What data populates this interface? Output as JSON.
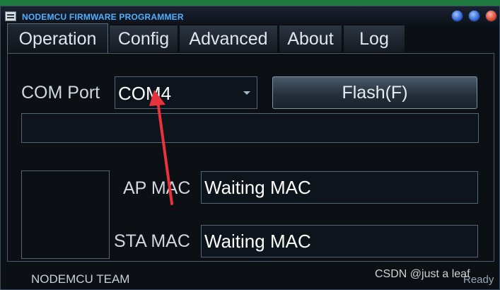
{
  "window": {
    "title": "NODEMCU FIRMWARE PROGRAMMER",
    "controls": [
      "minimize",
      "maximize",
      "close"
    ]
  },
  "tabs": [
    {
      "label": "Operation",
      "active": true
    },
    {
      "label": "Config",
      "active": false
    },
    {
      "label": "Advanced",
      "active": false
    },
    {
      "label": "About",
      "active": false
    },
    {
      "label": "Log",
      "active": false
    }
  ],
  "operation": {
    "com_port_label": "COM Port",
    "com_port_value": "COM4",
    "flash_label": "Flash(F)",
    "ap_mac_label": "AP MAC",
    "ap_mac_value": "Waiting MAC",
    "sta_mac_label": "STA MAC",
    "sta_mac_value": "Waiting MAC"
  },
  "footer": {
    "team": "NODEMCU TEAM",
    "status": "Ready"
  },
  "watermark": "CSDN @just a leaf",
  "colors": {
    "title_text": "#4fb0ff",
    "annotation_arrow": "#e8323c",
    "background": "#0c1015"
  }
}
